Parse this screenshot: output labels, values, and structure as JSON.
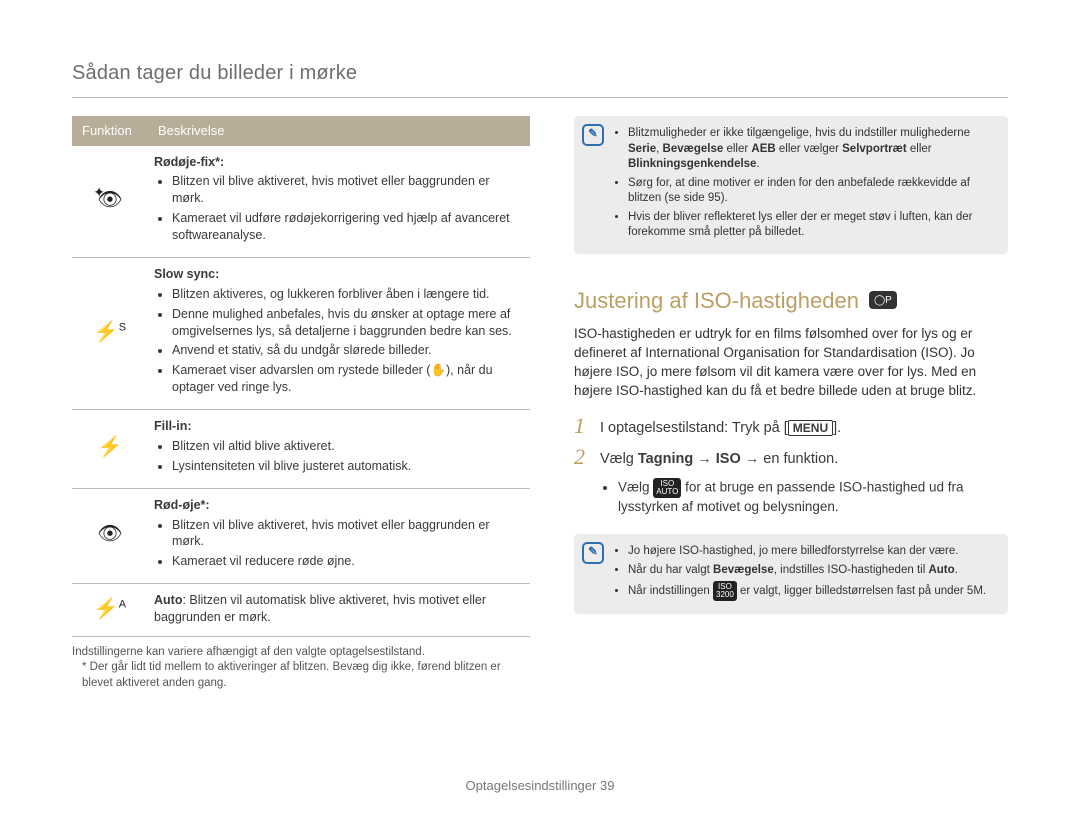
{
  "page_title": "Sådan tager du billeder i mørke",
  "table": {
    "headers": {
      "col1": "Funktion",
      "col2": "Beskrivelse"
    },
    "rows": [
      {
        "icon_name": "redeye-fix-icon",
        "icon_glyph": "👁",
        "title": "Rødøje-fix*:",
        "bullets": [
          "Blitzen vil blive aktiveret, hvis motivet eller baggrunden er mørk.",
          "Kameraet vil udføre rødøjekorrigering ved hjælp af avanceret softwareanalyse."
        ]
      },
      {
        "icon_name": "slow-sync-icon",
        "icon_glyph": "⚡",
        "icon_sup": "S",
        "title": "Slow sync:",
        "bullets": [
          "Blitzen aktiveres, og lukkeren forbliver åben i længere tid.",
          "Denne mulighed anbefales, hvis du ønsker at optage mere af omgivelsernes lys, så detaljerne i baggrunden bedre kan ses.",
          "Anvend et stativ, så du undgår slørede billeder.",
          "Kameraet viser advarslen om rystede billeder (✋), når du optager ved ringe lys."
        ]
      },
      {
        "icon_name": "fill-in-icon",
        "icon_glyph": "⚡",
        "title": "Fill-in:",
        "bullets": [
          "Blitzen vil altid blive aktiveret.",
          "Lysintensiteten vil blive justeret automatisk."
        ]
      },
      {
        "icon_name": "redeye-icon",
        "icon_glyph": "👁",
        "title": "Rød-øje*:",
        "bullets": [
          "Blitzen vil blive aktiveret, hvis motivet eller baggrunden er mørk.",
          "Kameraet vil reducere røde øjne."
        ]
      },
      {
        "icon_name": "auto-flash-icon",
        "icon_glyph": "⚡",
        "icon_sup": "A",
        "title_inline": "Auto",
        "text": ": Blitzen vil automatisk blive aktiveret, hvis motivet eller baggrunden er mørk."
      }
    ]
  },
  "footnotes": {
    "line1": "Indstillingerne kan variere afhængigt af den valgte optagelsestilstand.",
    "line2": "* Der går lidt tid mellem to aktiveringer af blitzen. Bevæg dig ikke, førend blitzen er blevet aktiveret anden gang."
  },
  "notebox1": {
    "items": [
      {
        "pre": "Blitzmuligheder er ikke tilgængelige, hvis du indstiller mulighederne ",
        "b1": "Serie",
        "mid1": ", ",
        "b2": "Bevægelse",
        "mid2": " eller ",
        "b3": "AEB",
        "mid3": " eller vælger ",
        "b4": "Selvportræt",
        "mid4": " eller ",
        "b5": "Blinkningsgenkendelse",
        "post": "."
      },
      {
        "text": "Sørg for, at dine motiver er inden for den anbefalede rækkevidde af blitzen (se side 95)."
      },
      {
        "text": "Hvis der bliver reflekteret lys eller der er meget støv i luften, kan der forekomme små pletter på billedet."
      }
    ]
  },
  "section": {
    "heading": "Justering af ISO-hastigheden",
    "mode_badge": "◯P",
    "body": "ISO-hastigheden er udtryk for en films følsomhed over for lys og er defineret af International Organisation for Standardisation (ISO). Jo højere ISO, jo mere følsom vil dit kamera være over for lys. Med en højere ISO-hastighed kan du få et bedre billede uden at bruge blitz.",
    "steps": [
      {
        "num": "1",
        "text_pre": "I optagelsestilstand: Tryk på [",
        "menu": "MENU",
        "text_post": "]."
      },
      {
        "num": "2",
        "text_pre": "Vælg ",
        "b1": "Tagning",
        "arrow1": " → ",
        "b2": "ISO",
        "arrow2": " → en funktion."
      }
    ],
    "substep_pre": "Vælg ",
    "substep_pill_top": "ISO",
    "substep_pill_bot": "AUTO",
    "substep_post": " for at bruge en passende ISO-hastighed ud fra lysstyrken af motivet og belysningen."
  },
  "notebox2": {
    "items": [
      {
        "text": "Jo højere ISO-hastighed, jo mere billedforstyrrelse kan der være."
      },
      {
        "pre": "Når du har valgt ",
        "b1": "Bevægelse",
        "mid1": ", indstilles ISO-hastigheden til ",
        "b2": "Auto",
        "post": "."
      },
      {
        "pre": "Når indstillingen ",
        "pill_top": "ISO",
        "pill_bot": "3200",
        "post": " er valgt, ligger billedstørrelsen fast på under 5M."
      }
    ]
  },
  "footer": {
    "label": "Optagelsesindstillinger",
    "page": "39"
  }
}
